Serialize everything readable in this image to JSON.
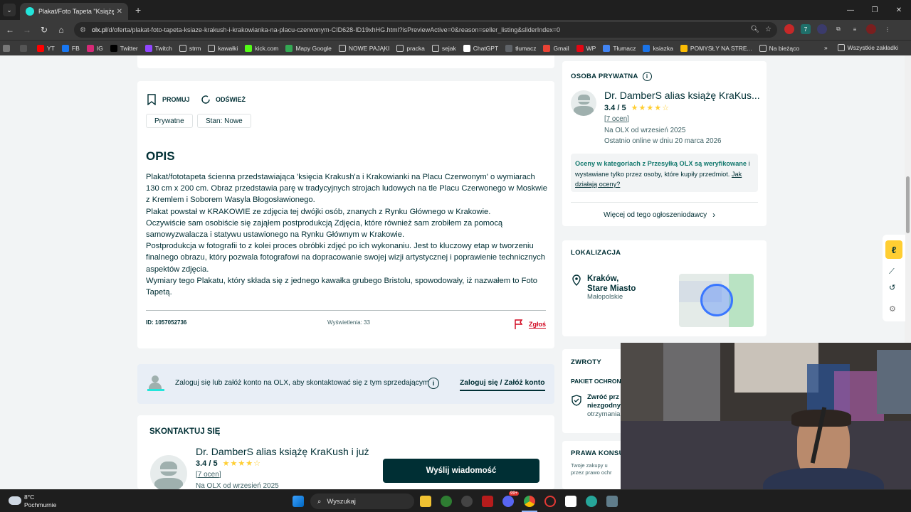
{
  "browser": {
    "tab_title": "Plakat/Foto Tapeta \"Książę KraK",
    "new_tab": "+",
    "url_host": "olx.pl",
    "url_path": "/d/oferta/plakat-foto-tapeta-ksiaze-krakush-i-krakowianka-na-placu-czerwonym-CID628-ID19xhHG.html?isPreviewActive=0&reason=seller_listing&sliderIndex=0",
    "bookmarks": [
      {
        "label": "YT",
        "color": "#ff0000"
      },
      {
        "label": "FB",
        "color": "#1877f2"
      },
      {
        "label": "IG",
        "color": "#d62976"
      },
      {
        "label": "Twitter",
        "color": "#000000"
      },
      {
        "label": "Twitch",
        "color": "#9146ff"
      },
      {
        "label": "strm",
        "color": "folder"
      },
      {
        "label": "kawałki",
        "color": "folder"
      },
      {
        "label": "kick.com",
        "color": "#53fc18"
      },
      {
        "label": "Mapy Google",
        "color": "#34a853"
      },
      {
        "label": "NOWE PAJĄKI",
        "color": "folder"
      },
      {
        "label": "pracka",
        "color": "folder"
      },
      {
        "label": "sejak",
        "color": "folder"
      },
      {
        "label": "ChatGPT",
        "color": "#ffffff"
      },
      {
        "label": "tłumacz",
        "color": "#5f6368"
      },
      {
        "label": "Gmail",
        "color": "#ea4335"
      },
      {
        "label": "WP",
        "color": "#e30613"
      },
      {
        "label": "Tłumacz",
        "color": "#4285f4"
      },
      {
        "label": "ksiazka",
        "color": "#1a73e8"
      },
      {
        "label": "POMYSŁY NA STRE...",
        "color": "#fbbc04"
      },
      {
        "label": "Na bieżąco",
        "color": "folder"
      }
    ],
    "bookmarks_more": "»",
    "bookmarks_all": "Wszystkie zakładki"
  },
  "listing": {
    "promote_label": "PROMUJ",
    "refresh_label": "ODŚWIEŻ",
    "chips": [
      "Prywatne",
      "Stan: Nowe"
    ],
    "description_title": "OPIS",
    "description_paragraphs": [
      "Plakat/fototapeta ścienna przedstawiająca 'księcia Krakush'a i Krakowianki na Placu Czerwonym' o wymiarach 130 cm x 200 cm. Obraz przedstawia parę w tradycyjnych strojach ludowych na tle Placu Czerwonego w Moskwie z Kremlem i Soborem Wasyla Błogosławionego.",
      "Plakat powstał w KRAKOWIE ze zdjęcia tej dwójki osób, znanych z Rynku Głównego w Krakowie.",
      "Oczywiście sam osobiście się zająłem postprodukcją Zdjęcia, które również sam zrobiłem za pomocą samowyzwalacza i statywu ustawionego na Rynku Głównym w Krakowie.",
      "Postprodukcja w fotografii to z kolei proces obróbki zdjęć po ich wykonaniu. Jest to kluczowy etap w tworzeniu finalnego obrazu, który pozwala fotografowi na dopracowanie swojej wizji artystycznej i poprawienie technicznych aspektów zdjęcia.",
      "Wymiary tego Plakatu, który składa się z jednego kawałka grubego Bristolu, spowodowały, iż nazwałem to Foto Tapetą."
    ],
    "id_label": "ID: 1057052736",
    "views_label": "Wyświetlenia: 33",
    "report_label": "Zgłoś"
  },
  "login_bar": {
    "text": "Zaloguj się lub załóż konto na OLX, aby skontaktować się z tym sprzedającym",
    "link": "Zaloguj się / Załóż konto"
  },
  "contact": {
    "title": "SKONTAKTUJ SIĘ",
    "name": "Dr. DamberS alias książę KraKush i już",
    "rating": "3.4 / 5",
    "rating_value": 3.4,
    "reviews": "7 ocen",
    "since": "Na OLX od wrzesień 2025",
    "message_button": "Wyślij wiadomość"
  },
  "seller": {
    "section_title": "OSOBA PRYWATNA",
    "name": "Dr. DamberS alias książę KraKus...",
    "rating": "3.4 / 5",
    "rating_value": 3.4,
    "reviews": "7 ocen",
    "since": "Na OLX od wrzesień 2025",
    "last_online": "Ostatnio online w dniu 20 marca 2026",
    "notice_bold": "Oceny w kategoriach z Przesyłką OLX są weryfikowane",
    "notice_rest": " i wystawiane tylko przez osoby, które kupiły przedmiot. ",
    "notice_link": "Jak działają oceny?",
    "more_ads": "Więcej od tego ogłoszeniodawcy"
  },
  "location": {
    "title": "LOKALIZACJA",
    "city": "Kraków,",
    "district": "Stare Miasto",
    "region": "Małopolskie"
  },
  "returns": {
    "title": "ZWROTY",
    "package": "PAKIET OCHRONN",
    "line1": "Zwróć prz",
    "line2": "niezgodny",
    "line3": "otrzymania"
  },
  "rights": {
    "title": "PRAWA KONSU",
    "line1": "Twoje zakupy u",
    "line2": "przez prawo ochr"
  },
  "taskbar": {
    "temp": "8°C",
    "weather": "Pochmurnie",
    "search": "Wyszukaj",
    "badge": "99+"
  }
}
